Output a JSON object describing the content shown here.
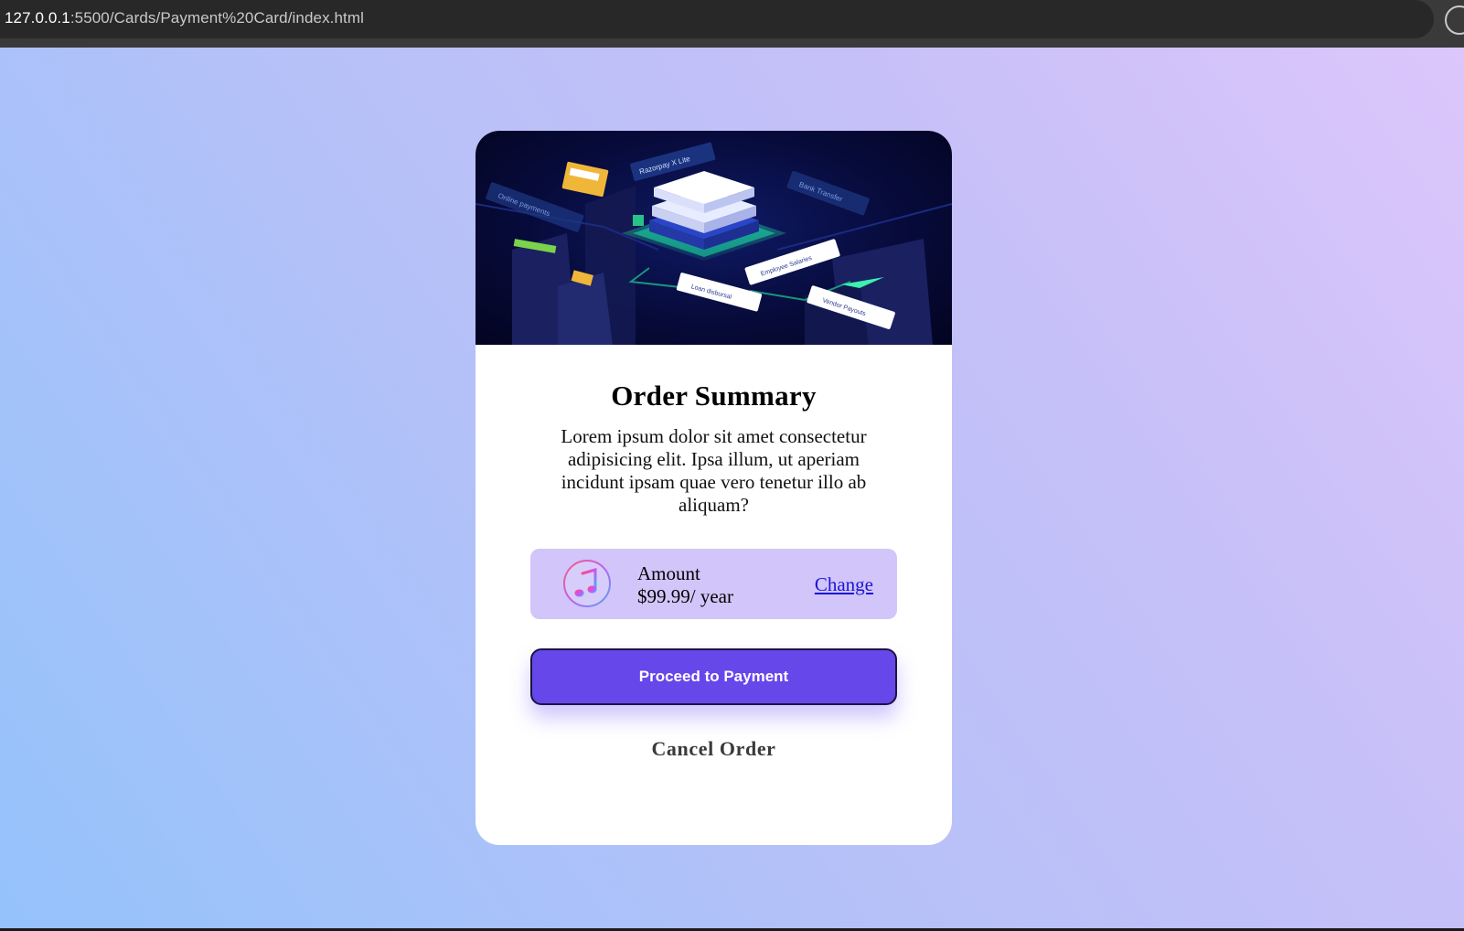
{
  "browser": {
    "url_host": "127.0.0.1",
    "url_rest": ":5500/Cards/Payment%20Card/index.html"
  },
  "hero": {
    "labels": {
      "brand": "Razorpay X Lite",
      "online_payments": "Online payments",
      "bank_transfer": "Bank Transfer",
      "employee_salaries": "Employee Salaries",
      "loan_disbursal": "Loan disbursal",
      "vendor_payouts": "Vendor Payouts"
    }
  },
  "card": {
    "title": "Order Summary",
    "description": "Lorem ipsum dolor sit amet consectetur adipisicing elit. Ipsa illum, ut aperiam incidunt ipsam quae vero tenetur illo ab aliquam?",
    "plan": {
      "icon": "music-note-icon",
      "label": "Amount",
      "price": "$99.99/ year",
      "change_label": "Change"
    },
    "pay_label": "Proceed to Payment",
    "cancel_label": "Cancel Order"
  },
  "colors": {
    "accent": "#6547ea",
    "plan_bg": "#d1c5fa",
    "link": "#1c14d8"
  }
}
